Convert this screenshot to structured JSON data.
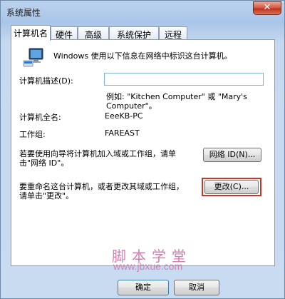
{
  "window": {
    "title": "系统属性",
    "close_label": "✕"
  },
  "tabs": [
    {
      "label": "计算机名",
      "active": true
    },
    {
      "label": "硬件",
      "active": false
    },
    {
      "label": "高级",
      "active": false
    },
    {
      "label": "系统保护",
      "active": false
    },
    {
      "label": "远程",
      "active": false
    }
  ],
  "info_text": "Windows 使用以下信息在网络中标识这台计算机。",
  "description": {
    "label": "计算机描述(D):",
    "value": "",
    "example_line1": "例如: \"Kitchen Computer\" 或 \"Mary's",
    "example_line2": "Computer\"。"
  },
  "full_name": {
    "label": "计算机全名:",
    "value": "EeeKB-PC"
  },
  "workgroup": {
    "label": "工作组:",
    "value": "FAREAST"
  },
  "network_id": {
    "text_line1": "若要使用向导将计算机加入域或工作组，请单",
    "text_line2": "击\"网络 ID\"。",
    "button_label": "网络 ID(N)..."
  },
  "rename": {
    "text_line1": "要重命名这台计算机，或者更改其域或工作组，",
    "text_line2": "请单击\"更改\"。",
    "button_label": "更改(C)..."
  },
  "watermark": {
    "title": "脚本学堂",
    "url": "www.jbxue.com"
  },
  "footer": {
    "ok_label": "确定",
    "cancel_label": "取消"
  },
  "icons": {
    "computer": "computer-icon",
    "close": "close-icon"
  }
}
